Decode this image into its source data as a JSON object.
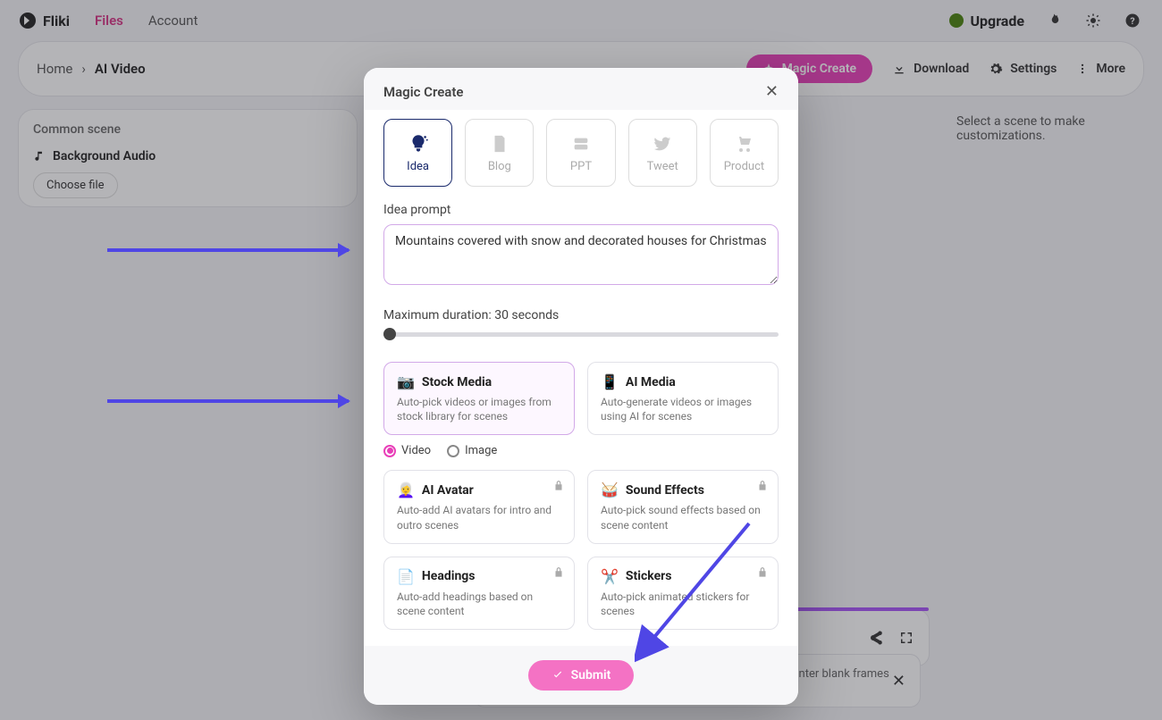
{
  "brand": "Fliki",
  "nav": {
    "files": "Files",
    "account": "Account"
  },
  "upgrade": "Upgrade",
  "breadcrumb": {
    "home": "Home",
    "current": "AI Video"
  },
  "toolbar": {
    "magic": "Magic Create",
    "download": "Download",
    "settings": "Settings",
    "more": "More"
  },
  "leftPanel": {
    "title": "Common scene",
    "bgAudio": "Background Audio",
    "chooseFile": "Choose file"
  },
  "rightHint": "Select a scene to make customizations.",
  "toast": {
    "text": "Please note that this is just a quick preview and if you encounter blank frames or silent audio, try playing again."
  },
  "modal": {
    "title": "Magic Create",
    "tabs": [
      {
        "key": "idea",
        "label": "Idea",
        "selected": true
      },
      {
        "key": "blog",
        "label": "Blog"
      },
      {
        "key": "ppt",
        "label": "PPT"
      },
      {
        "key": "tweet",
        "label": "Tweet"
      },
      {
        "key": "product",
        "label": "Product"
      }
    ],
    "promptLabel": "Idea prompt",
    "promptValue": "Mountains covered with snow and decorated houses for Christmas",
    "durationLabel": "Maximum duration: 30 seconds",
    "durationValue": 30,
    "mediaRadio": {
      "video": "Video",
      "image": "Image",
      "selected": "video"
    },
    "cards": {
      "stock": {
        "title": "Stock Media",
        "desc": "Auto-pick videos or images from stock library for scenes",
        "emoji": "📷",
        "selected": true
      },
      "aimedia": {
        "title": "AI Media",
        "desc": "Auto-generate videos or images using AI for scenes",
        "emoji": "📱"
      },
      "avatar": {
        "title": "AI Avatar",
        "desc": "Auto-add AI avatars for intro and outro scenes",
        "emoji": "👩‍🦳",
        "locked": true
      },
      "sfx": {
        "title": "Sound Effects",
        "desc": "Auto-pick sound effects based on scene content",
        "emoji": "🥁",
        "locked": true
      },
      "headings": {
        "title": "Headings",
        "desc": "Auto-add headings based on scene content",
        "emoji": "📄",
        "locked": true
      },
      "stickers": {
        "title": "Stickers",
        "desc": "Auto-pick animated stickers for scenes",
        "emoji": "✂️",
        "locked": true
      }
    },
    "submit": "Submit"
  },
  "progressPct": 100
}
